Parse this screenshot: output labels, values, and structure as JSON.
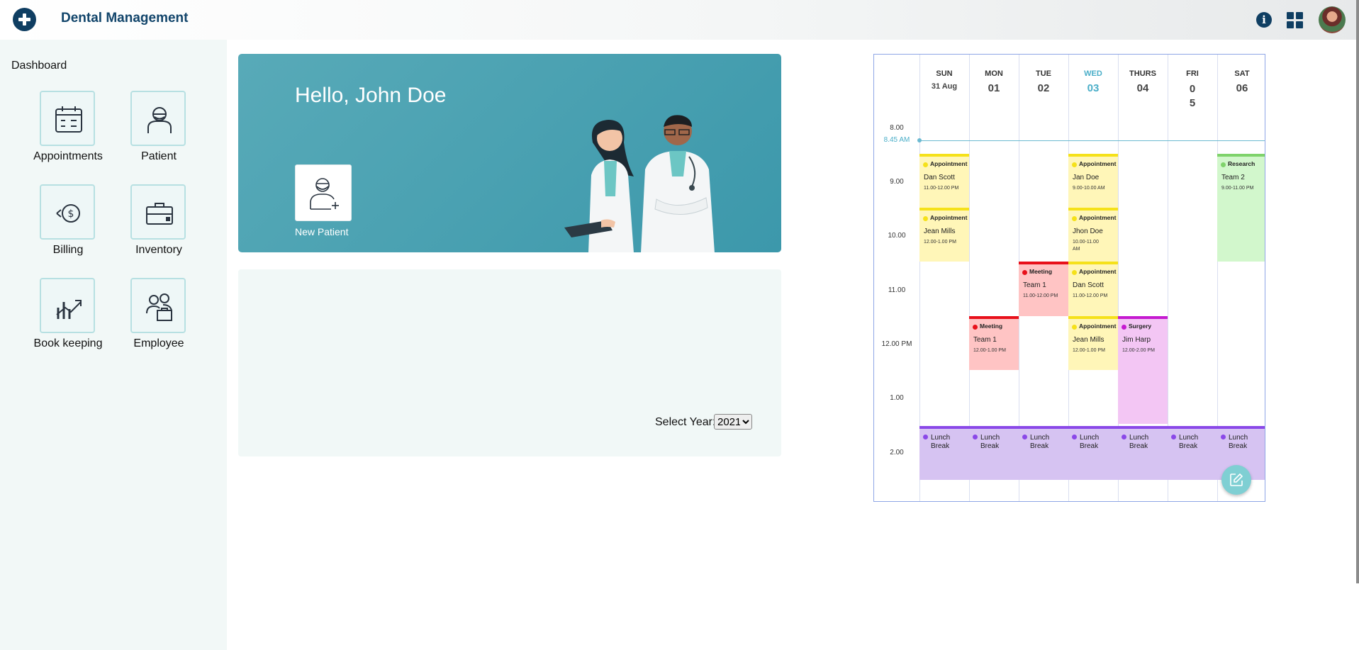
{
  "header": {
    "title": "Dental Management"
  },
  "sidebar": {
    "section_label": "Dashboard",
    "items": [
      {
        "label": "Appointments",
        "icon": "calendar-icon"
      },
      {
        "label": "Patient",
        "icon": "patient-icon"
      },
      {
        "label": "Billing",
        "icon": "billing-icon"
      },
      {
        "label": "Inventory",
        "icon": "inventory-icon"
      },
      {
        "label": "Book keeping",
        "icon": "bookkeeping-icon"
      },
      {
        "label": "Employee",
        "icon": "employee-icon"
      }
    ]
  },
  "hero": {
    "greeting": "Hello, John Doe",
    "new_patient_label": "New Patient"
  },
  "chart_panel": {
    "year_label": "Select Year:",
    "year_value": "2021",
    "year_options": [
      "2021"
    ]
  },
  "calendar": {
    "days": [
      {
        "name": "SUN",
        "date": "31 Aug"
      },
      {
        "name": "MON",
        "date": "01"
      },
      {
        "name": "TUE",
        "date": "02"
      },
      {
        "name": "WED",
        "date": "03"
      },
      {
        "name": "THURS",
        "date": "04"
      },
      {
        "name": "FRI",
        "date": "0\n5"
      },
      {
        "name": "SAT",
        "date": "06"
      }
    ],
    "hours": [
      "8.00",
      "9.00",
      "10.00",
      "11.00",
      "12.00 PM",
      "1.00",
      "2.00"
    ],
    "now_label": "8.45 AM",
    "events": [
      {
        "type": "Appointment",
        "name": "Dan Scott",
        "time": "11.00-12.00 PM"
      },
      {
        "type": "Appointment",
        "name": "Jean Mills",
        "time": "12.00-1.00 PM"
      },
      {
        "type": "Meeting",
        "name": "Team 1",
        "time": "12.00-1.00 PM"
      },
      {
        "type": "Meeting",
        "name": "Team 1",
        "time": "11.00-12.00 PM"
      },
      {
        "type": "Appointment",
        "name": "Jan Doe",
        "time": "9.00-10.00 AM"
      },
      {
        "type": "Appointment",
        "name": "Jhon Doe",
        "time": "10.00-11.00 AM"
      },
      {
        "type": "Appointment",
        "name": "Dan Scott",
        "time": "11.00-12.00 PM"
      },
      {
        "type": "Appointment",
        "name": "Jean Mills",
        "time": "12.00-1.00 PM"
      },
      {
        "type": "Surgery",
        "name": "Jim Harp",
        "time": "12.00-2.00 PM"
      },
      {
        "type": "Research",
        "name": "Team 2",
        "time": "9.00-11.00 PM"
      }
    ],
    "lunch_label": "Lunch Break"
  },
  "colors": {
    "brand": "#12456b",
    "hero": "#4aa3b3",
    "appointment": "#fff6b8",
    "meeting": "#ffc4c4",
    "surgery": "#f3c6f4",
    "research": "#d2f7cc",
    "lunch": "#d6c3f2",
    "accent": "#4aaec8"
  }
}
